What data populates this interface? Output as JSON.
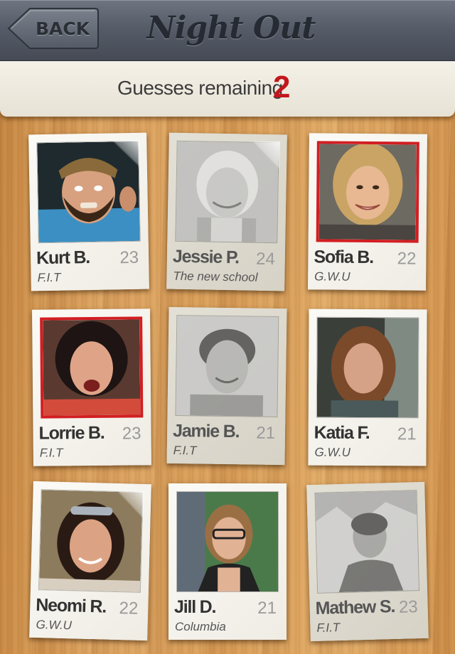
{
  "header": {
    "back_label": "BACK",
    "title": "Night Out"
  },
  "guesses": {
    "label": "Guesses remaining",
    "count": "2"
  },
  "accent_colors": {
    "selected_border": "#d21e22",
    "guess_count": "#c4161c",
    "top_bar": "#565c68"
  },
  "people": [
    {
      "name": "Kurt B.",
      "age": "23",
      "school": "F.I.T",
      "state": "normal",
      "photo": "man-beanie-photo"
    },
    {
      "name": "Jessie P.",
      "age": "24",
      "school": "The new school",
      "state": "faded",
      "photo": "woman-smiling-photo"
    },
    {
      "name": "Sofia B.",
      "age": "22",
      "school": "G.W.U",
      "state": "selected",
      "photo": "woman-blonde-photo"
    },
    {
      "name": "Lorrie B.",
      "age": "23",
      "school": "F.I.T",
      "state": "selected",
      "photo": "woman-laughing-photo"
    },
    {
      "name": "Jamie B.",
      "age": "21",
      "school": "F.I.T",
      "state": "faded",
      "photo": "man-smiling-photo"
    },
    {
      "name": "Katia F.",
      "age": "21",
      "school": "G.W.U",
      "state": "normal",
      "photo": "woman-curly-photo"
    },
    {
      "name": "Neomi R.",
      "age": "22",
      "school": "G.W.U",
      "state": "normal",
      "photo": "woman-sunglasses-photo"
    },
    {
      "name": "Jill D.",
      "age": "21",
      "school": "Columbia",
      "state": "normal",
      "photo": "woman-glasses-photo"
    },
    {
      "name": "Mathew S.",
      "age": "23",
      "school": "F.I.T",
      "state": "faded",
      "photo": "man-outdoor-photo"
    }
  ]
}
